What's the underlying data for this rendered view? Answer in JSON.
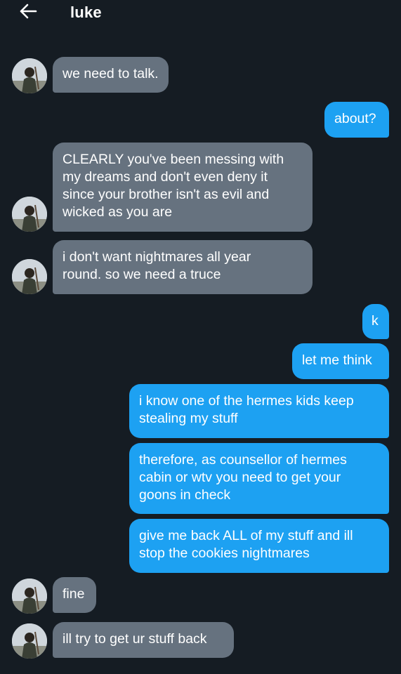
{
  "header": {
    "title": "luke",
    "back_icon": "arrow-left-icon"
  },
  "colors": {
    "background": "#151c23",
    "incoming_bubble": "#66727f",
    "outgoing_bubble": "#1da1f2",
    "text": "#ffffff"
  },
  "messages": [
    {
      "from": "luke",
      "lines": [
        "we need to talk."
      ]
    },
    {
      "from": "me",
      "lines": [
        "about?"
      ]
    },
    {
      "from": "luke",
      "lines": [
        "CLEARLY you've been messing with",
        "my dreams and don't even deny it",
        "since your brother isn't as evil and",
        "wicked as you are"
      ]
    },
    {
      "from": "luke",
      "lines": [
        "i don't want nightmares all year",
        "round. so we need a truce"
      ]
    },
    {
      "from": "me",
      "lines": [
        "k"
      ]
    },
    {
      "from": "me",
      "lines": [
        "let me think"
      ]
    },
    {
      "from": "me",
      "lines": [
        "i know one of the hermes kids keep",
        "stealing my stuff"
      ]
    },
    {
      "from": "me",
      "lines": [
        "therefore, as counsellor of hermes",
        "cabin or wtv you need to get your",
        "goons in check"
      ]
    },
    {
      "from": "me",
      "lines": [
        "give me back ALL of my stuff and ill",
        "stop the cookies nightmares"
      ]
    },
    {
      "from": "luke",
      "lines": [
        "fine"
      ]
    },
    {
      "from": "luke",
      "lines": [
        "ill try to get ur stuff back"
      ]
    }
  ]
}
